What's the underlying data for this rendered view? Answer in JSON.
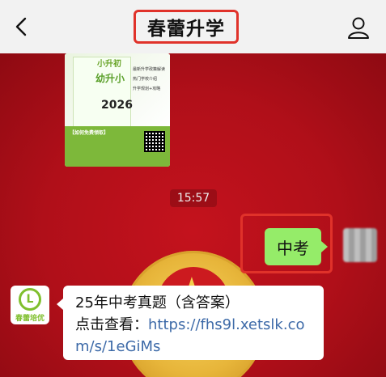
{
  "header": {
    "title": "春蕾升学",
    "back_icon": "chevron-left-icon",
    "profile_icon": "person-icon"
  },
  "poster": {
    "line1": "小升初",
    "line2": "幼升小",
    "year": "2026",
    "list": [
      "最新升学政策解读",
      "热门学校介绍",
      "升学规划+攻略"
    ],
    "bottom_title": "【如何免费领取】"
  },
  "chat": {
    "time": "15:57",
    "outgoing_message": "中考",
    "incoming": {
      "avatar_caption": "春蕾培优",
      "line1": "25年中考真题（含答案）",
      "prefix": "点击查看：",
      "link": "https://fhs9l.xetslk.com/s/1eGiMs"
    }
  },
  "colors": {
    "background_red": "#b00f19",
    "highlight_red": "#e0322a",
    "bubble_green": "#95ec69",
    "link_blue": "#3d6aa8"
  }
}
